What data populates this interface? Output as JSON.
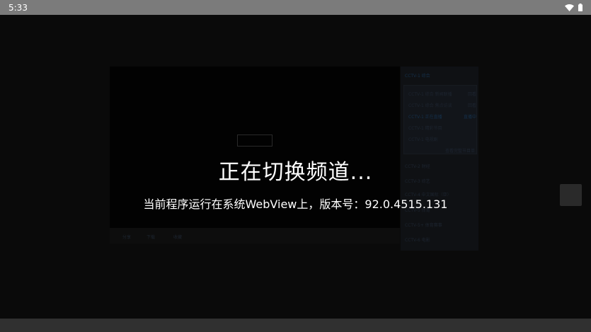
{
  "status_bar": {
    "time": "5:33",
    "icons": [
      "wifi-icon",
      "battery-icon"
    ]
  },
  "overlay": {
    "title": "正在切换频道...",
    "subtitle": "当前程序运行在系统WebView上，版本号：92.0.4515.131"
  },
  "background_page": {
    "sidebar_heading": "CCTV-1 综合",
    "sidebar_items": [
      {
        "label": "CCTV-1 综合 新闻联播",
        "tag": "回看"
      },
      {
        "label": "CCTV-1 综合 焦点访谈",
        "tag": "回看"
      },
      {
        "label": "CCTV-1 正在直播",
        "tag": "直播中"
      },
      {
        "label": "CCTV-1 精彩节目",
        "tag": ""
      },
      {
        "label": "CCTV-1 电视剧",
        "tag": ""
      }
    ],
    "sidebar_more": "查看完整节目单",
    "channel_list": [
      "CCTV-2 财经",
      "CCTV-3 综艺",
      "CCTV-4 中文国际（亚）",
      "CCTV-5 体育",
      "CCTV-5+ 体育赛事",
      "CCTV-6 电影"
    ],
    "bottom_bar": [
      "分享",
      "下载",
      "收藏"
    ]
  },
  "colors": {
    "status_bar": "#7b7b7b",
    "nav_bar": "#303030",
    "background": "#0c0c0c",
    "overlay_text": "#ffffff"
  }
}
